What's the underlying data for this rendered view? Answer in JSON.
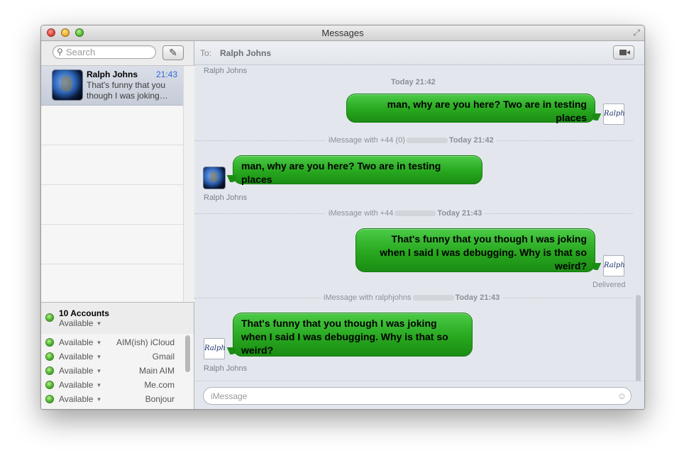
{
  "window": {
    "title": "Messages"
  },
  "sidebar": {
    "search_placeholder": "Search",
    "conversations": [
      {
        "name": "Ralph Johns",
        "time": "21:43",
        "preview": "That's funny that you though I was joking…"
      }
    ],
    "accounts_header": {
      "count_label": "10 Accounts",
      "status": "Available"
    },
    "accounts": [
      {
        "status": "Available",
        "name": "AIM(ish) iCloud"
      },
      {
        "status": "Available",
        "name": "Gmail"
      },
      {
        "status": "Available",
        "name": "Main AIM"
      },
      {
        "status": "Available",
        "name": "Me.com"
      },
      {
        "status": "Available",
        "name": "Bonjour"
      }
    ]
  },
  "header": {
    "to_label": "To:",
    "recipient": "Ralph Johns"
  },
  "transcript": {
    "top_sender": "Ralph Johns",
    "ts1": "Today 21:42",
    "msg1": "man, why are you here?  Two are in testing places",
    "sep1": {
      "prefix": "iMessage with +44 (0)",
      "time": "Today 21:42"
    },
    "msg2": "man, why are you here?  Two are in testing places",
    "msg2_sender": "Ralph Johns",
    "sep2": {
      "prefix": "iMessage with +44",
      "time": "Today 21:43"
    },
    "msg3": "That's funny that you though I was joking when I said I was debugging.  Why is that so weird?",
    "delivered": "Delivered",
    "sep3": {
      "prefix": "iMessage with ralphjohns",
      "time": "Today 21:43"
    },
    "msg4": "That's funny that you though I was joking when I said I was debugging.  Why is that so weird?",
    "msg4_sender": "Ralph Johns"
  },
  "avatars": {
    "signature_text": "Ralph"
  },
  "compose": {
    "placeholder": "iMessage"
  },
  "icons": {
    "search": "magnifier",
    "compose": "pencil-square",
    "video": "video-camera",
    "emoji": "smiley",
    "fullscreen": "diagonal-arrows"
  },
  "colors": {
    "bubble": "#2ea626",
    "status_available": "#42b024",
    "timestamp": "#2f6bd6"
  }
}
